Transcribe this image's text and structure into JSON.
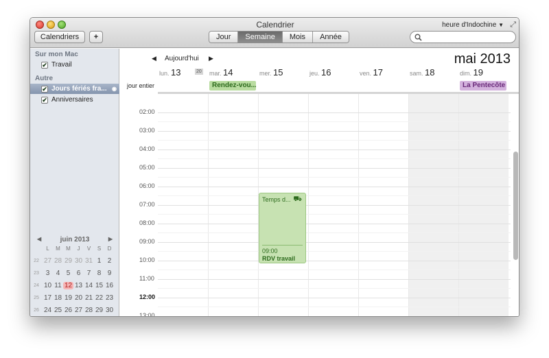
{
  "window": {
    "title": "Calendrier",
    "timezone": "heure d'Indochine"
  },
  "toolbar": {
    "calendars_label": "Calendriers",
    "add_label": "+",
    "views": [
      {
        "label": "Jour",
        "selected": false
      },
      {
        "label": "Semaine",
        "selected": true
      },
      {
        "label": "Mois",
        "selected": false
      },
      {
        "label": "Année",
        "selected": false
      }
    ],
    "search_placeholder": ""
  },
  "sidebar": {
    "sections": [
      {
        "title": "Sur mon Mac",
        "items": [
          {
            "label": "Travail",
            "checked": true,
            "color": "#4a9a2a"
          }
        ]
      },
      {
        "title": "Autre",
        "items": [
          {
            "label": "Jours fériés fra...",
            "checked": true,
            "selected": true
          },
          {
            "label": "Anniversaires",
            "checked": true
          }
        ]
      }
    ],
    "mini_calendar": {
      "month": "juin 2013",
      "day_names": [
        "L",
        "M",
        "M",
        "J",
        "V",
        "S",
        "D"
      ],
      "weeks": [
        {
          "wk": "22",
          "days": [
            "27",
            "28",
            "29",
            "30",
            "31",
            "1",
            "2"
          ]
        },
        {
          "wk": "23",
          "days": [
            "3",
            "4",
            "5",
            "6",
            "7",
            "8",
            "9"
          ]
        },
        {
          "wk": "24",
          "days": [
            "10",
            "11",
            "12",
            "13",
            "14",
            "15",
            "16"
          ]
        },
        {
          "wk": "25",
          "days": [
            "17",
            "18",
            "19",
            "20",
            "21",
            "22",
            "23"
          ]
        },
        {
          "wk": "26",
          "days": [
            "24",
            "25",
            "26",
            "27",
            "28",
            "29",
            "30"
          ]
        }
      ],
      "today": "12"
    }
  },
  "main": {
    "today_label": "Aujourd'hui",
    "month_title": "mai 2013",
    "week_number": "20",
    "days": [
      {
        "name": "lun.",
        "num": "13"
      },
      {
        "name": "mar.",
        "num": "14"
      },
      {
        "name": "mer.",
        "num": "15"
      },
      {
        "name": "jeu.",
        "num": "16"
      },
      {
        "name": "ven.",
        "num": "17"
      },
      {
        "name": "sam.",
        "num": "18"
      },
      {
        "name": "dim.",
        "num": "19"
      }
    ],
    "allday_label": "jour entier",
    "allday_events": [
      {
        "title": "Rendez-vou...",
        "day": 1,
        "color": "#b9dca0",
        "text_color": "#2c6a1c"
      },
      {
        "title": "La Pentecôte",
        "day": 6,
        "color": "#d3b2dd",
        "text_color": "#6a2a7a"
      }
    ],
    "hours": [
      "02:00",
      "03:00",
      "04:00",
      "05:00",
      "06:00",
      "07:00",
      "08:00",
      "09:00",
      "10:00",
      "11:00",
      "12:00",
      "13:00"
    ],
    "bold_hour": "12:00",
    "events": [
      {
        "travel": "Temps d...",
        "time": "09:00",
        "title": "RDV travail",
        "day": 2,
        "color": "#c7e2b2"
      }
    ]
  }
}
